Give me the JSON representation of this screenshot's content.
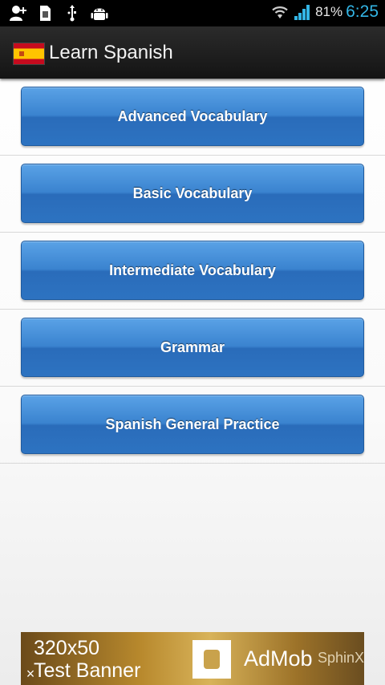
{
  "status_bar": {
    "battery_percent": "81%",
    "time": "6:25",
    "left_icons": [
      "add-contact-icon",
      "sim-card-icon",
      "usb-icon",
      "android-debug-icon"
    ],
    "right_icons": [
      "wifi-icon",
      "cell-signal-icon"
    ]
  },
  "action_bar": {
    "title": "Learn Spanish",
    "icon": "spain-flag-icon"
  },
  "menu": {
    "items": [
      {
        "label": "Advanced Vocabulary"
      },
      {
        "label": "Basic Vocabulary"
      },
      {
        "label": "Intermediate Vocabulary"
      },
      {
        "label": "Grammar"
      },
      {
        "label": "Spanish General Practice"
      }
    ]
  },
  "ad": {
    "size_text": "320x50",
    "test_text": "Test Banner",
    "brand": "AdMob",
    "extra": "SphinX",
    "close": "×"
  },
  "colors": {
    "button_top": "#5aa2e6",
    "button_bottom": "#2d73c1",
    "clock": "#33b5e5",
    "action_bar": "#1e1e1e"
  }
}
